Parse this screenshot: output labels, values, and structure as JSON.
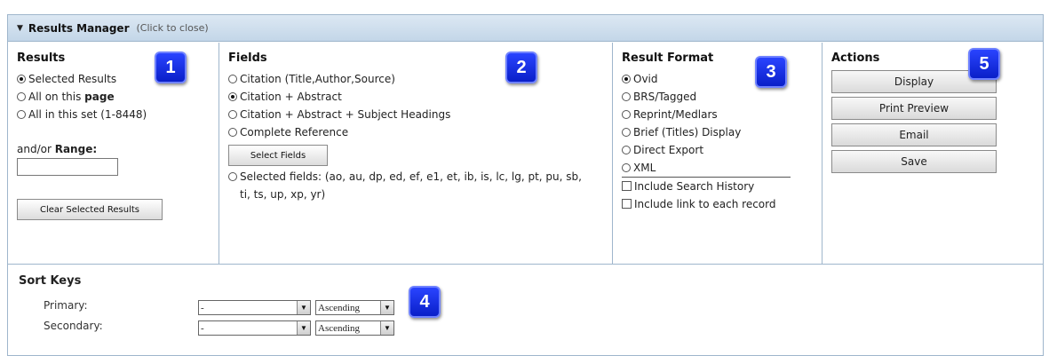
{
  "header": {
    "title": "Results Manager",
    "hint": "(Click to close)",
    "arrow": "▼"
  },
  "results": {
    "heading": "Results",
    "options": [
      {
        "label": "Selected Results",
        "selected": true
      },
      {
        "label": "All on this ",
        "bold": "page",
        "selected": false
      },
      {
        "label": "All in this set (1-8448)",
        "selected": false
      }
    ],
    "range_label": "and/or ",
    "range_bold": "Range:",
    "range_value": "",
    "clear_button": "Clear Selected Results"
  },
  "fields": {
    "heading": "Fields",
    "options": [
      {
        "label": "Citation (Title,Author,Source)",
        "selected": false
      },
      {
        "label": "Citation + Abstract",
        "selected": true
      },
      {
        "label": "Citation + Abstract + Subject Headings",
        "selected": false
      },
      {
        "label": "Complete Reference",
        "selected": false
      }
    ],
    "select_fields_button": "Select Fields",
    "selected_fields_label": "Selected fields: (ao, au, dp, ed, ef, e1, et, ib, is, lc, lg, pt, pu, sb, ti, ts, up, xp, yr)"
  },
  "result_format": {
    "heading": "Result Format",
    "options": [
      {
        "label": "Ovid",
        "selected": true
      },
      {
        "label": "BRS/Tagged",
        "selected": false
      },
      {
        "label": "Reprint/Medlars",
        "selected": false
      },
      {
        "label": "Brief (Titles) Display",
        "selected": false
      },
      {
        "label": "Direct Export",
        "selected": false
      },
      {
        "label": "XML",
        "selected": false
      }
    ],
    "include_history": "Include Search History",
    "include_link": "Include link to each record"
  },
  "actions": {
    "heading": "Actions",
    "buttons": [
      "Display",
      "Print Preview",
      "Email",
      "Save"
    ]
  },
  "sort": {
    "heading": "Sort Keys",
    "primary_label": "Primary:",
    "secondary_label": "Secondary:",
    "primary_field": "-",
    "primary_order": "Ascending",
    "secondary_field": "-",
    "secondary_order": "Ascending"
  },
  "badges": [
    "1",
    "2",
    "3",
    "4",
    "5"
  ],
  "colors": {
    "badge": "#1a33e6",
    "border": "#9fb6cc",
    "header_bg": "#c3d6e8"
  }
}
